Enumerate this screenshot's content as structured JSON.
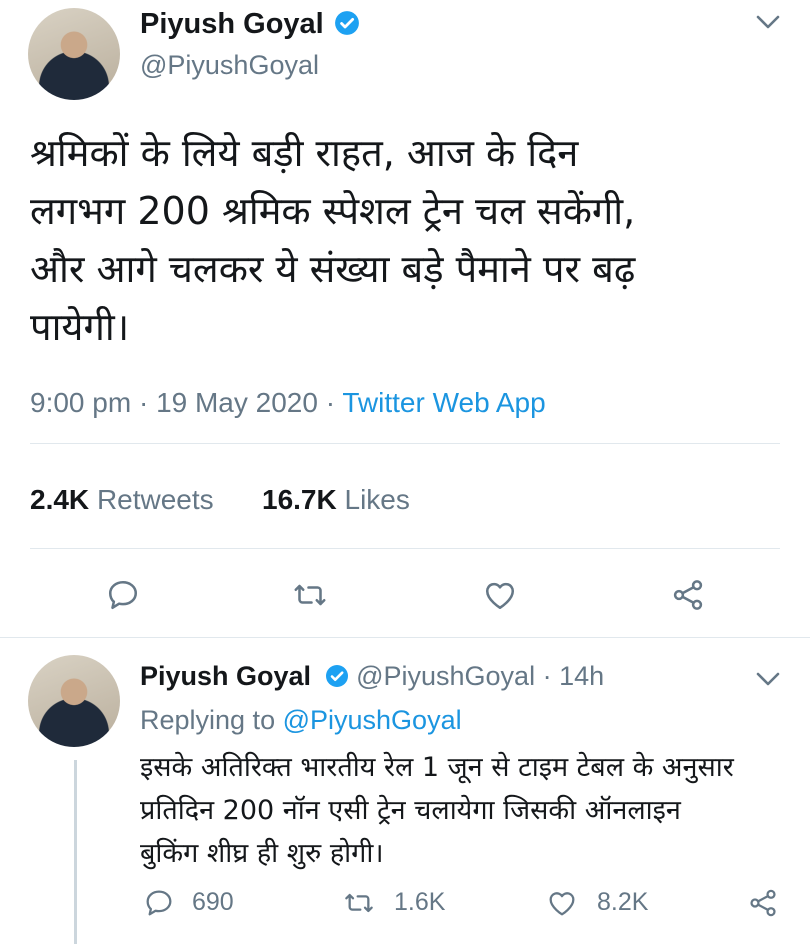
{
  "main_tweet": {
    "author_name": "Piyush Goyal",
    "author_handle": "@PiyushGoyal",
    "text": "श्रमिकों के लिये बड़ी राहत, आज के दिन\nलगभग 200 श्रमिक स्पेशल ट्रेन चल सकेंगी,\nऔर आगे चलकर ये संख्या बड़े पैमाने पर बढ़\nपायेगी।",
    "time": "9:00 pm",
    "date": "19 May 2020",
    "source": "Twitter Web App",
    "separator": " · ",
    "retweets_count": "2.4K",
    "retweets_label": "Retweets",
    "likes_count": "16.7K",
    "likes_label": "Likes"
  },
  "reply_tweet": {
    "author_name": "Piyush Goyal",
    "author_handle": "@PiyushGoyal",
    "age": "14h",
    "replying_to_label": "Replying to",
    "replying_to_handle": "@PiyushGoyal",
    "text": "इसके अतिरिक्त भारतीय रेल 1 जून से टाइम टेबल के अनुसार\nप्रतिदिन 200 नॉन एसी ट्रेन चलायेगा जिसकी ऑनलाइन\nबुकिंग शीघ्र ही शुरु होगी।",
    "reply_count": "690",
    "retweet_count": "1.6K",
    "like_count": "8.2K"
  },
  "colors": {
    "verified": "#1da1f2",
    "link": "#1b95e0",
    "muted": "#657786",
    "divider": "#e1e8ed"
  },
  "icons": [
    "verified-icon",
    "chevron-down-icon",
    "reply-icon",
    "retweet-icon",
    "like-icon",
    "share-icon"
  ]
}
